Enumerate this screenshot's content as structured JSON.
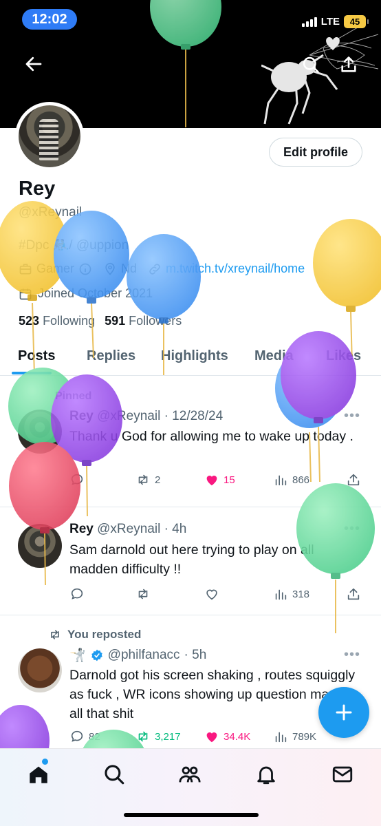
{
  "status_bar": {
    "time": "12:02",
    "network": "LTE",
    "battery": "45"
  },
  "profile": {
    "name": "Rey",
    "handle": "@xReynail",
    "bio": "#Dpc 🤼‍♂️/ @uppion",
    "category": "Gamer",
    "location": "Nd",
    "link": "m.twitch.tv/xreynail/home",
    "joined": "Joined October 2021",
    "following_count": "523",
    "following_label": "Following",
    "followers_count": "591",
    "followers_label": "Followers",
    "edit_button": "Edit profile"
  },
  "tabs": [
    "Posts",
    "Replies",
    "Highlights",
    "Media",
    "Likes"
  ],
  "posts": [
    {
      "pinned_label": "Pinned",
      "author": "Rey",
      "handle": "@xReynail",
      "date": "· 12/28/24",
      "text": "Thank u God for allowing me to wake up today .",
      "replies": "",
      "reposts": "2",
      "likes": "15",
      "views": "866"
    },
    {
      "author": "Rey",
      "handle": "@xReynail",
      "date": "· 4h",
      "text": "Sam darnold out here trying to play on all madden difficulty !!",
      "replies": "",
      "reposts": "",
      "likes": "",
      "views": "318"
    },
    {
      "reposted_label": "You reposted",
      "author": "🤺",
      "handle": "@philfanacc",
      "date": "· 5h",
      "text": "Darnold got his screen shaking , routes squiggly as fuck , WR icons showing up question marks , all that shit",
      "replies": "82",
      "reposts": "3,217",
      "likes": "34.4K",
      "views": "789K"
    }
  ],
  "colors": {
    "accent": "#1d9bf0",
    "like": "#f91880",
    "muted": "#536471"
  },
  "icons": {
    "nav": [
      "home-icon",
      "search-icon",
      "communities-icon",
      "notifications-icon",
      "messages-icon"
    ]
  }
}
